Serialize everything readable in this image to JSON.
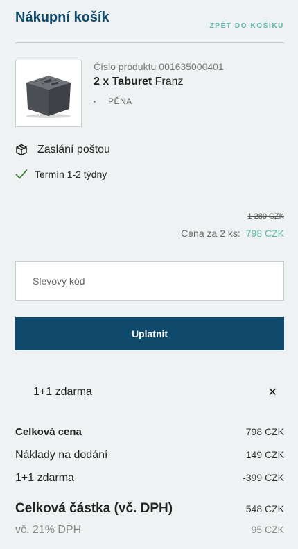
{
  "header": {
    "title": "Nákupní košík",
    "back_link": "ZPĚT DO KOŠÍKU"
  },
  "product": {
    "number_label": "Číslo produktu",
    "number": "001635000401",
    "quantity": "2 x",
    "name_bold": "Taburet",
    "name_rest": "Franz",
    "attribute": "PĚNA",
    "image_icon": "ottoman-product-image"
  },
  "shipping": {
    "icon": "box-icon",
    "label": "Zaslání poštou"
  },
  "delivery": {
    "icon": "check-icon",
    "label": "Termín 1-2 týdny",
    "color": "#3e7d3a"
  },
  "price": {
    "old": "1 280 CZK",
    "label": "Cena za 2 ks:",
    "value": "798 CZK"
  },
  "coupon": {
    "placeholder": "Slevový kód",
    "value": "",
    "apply_label": "Uplatnit"
  },
  "promo": {
    "label": "1+1 zdarma",
    "remove_icon": "close-icon"
  },
  "summary": {
    "total_label": "Celková cena",
    "total_value": "798 CZK",
    "shipping_label": "Náklady na dodání",
    "shipping_value": "149 CZK",
    "promo_label": "1+1 zdarma",
    "promo_value": "-399 CZK",
    "grand_label": "Celková částka (vč. DPH)",
    "grand_value": "548 CZK",
    "vat_label": "vč. 21% DPH",
    "vat_value": "95 CZK"
  },
  "colors": {
    "brand": "#0f4a6d",
    "accent": "#5cb7a8",
    "background": "#eef2f2"
  }
}
